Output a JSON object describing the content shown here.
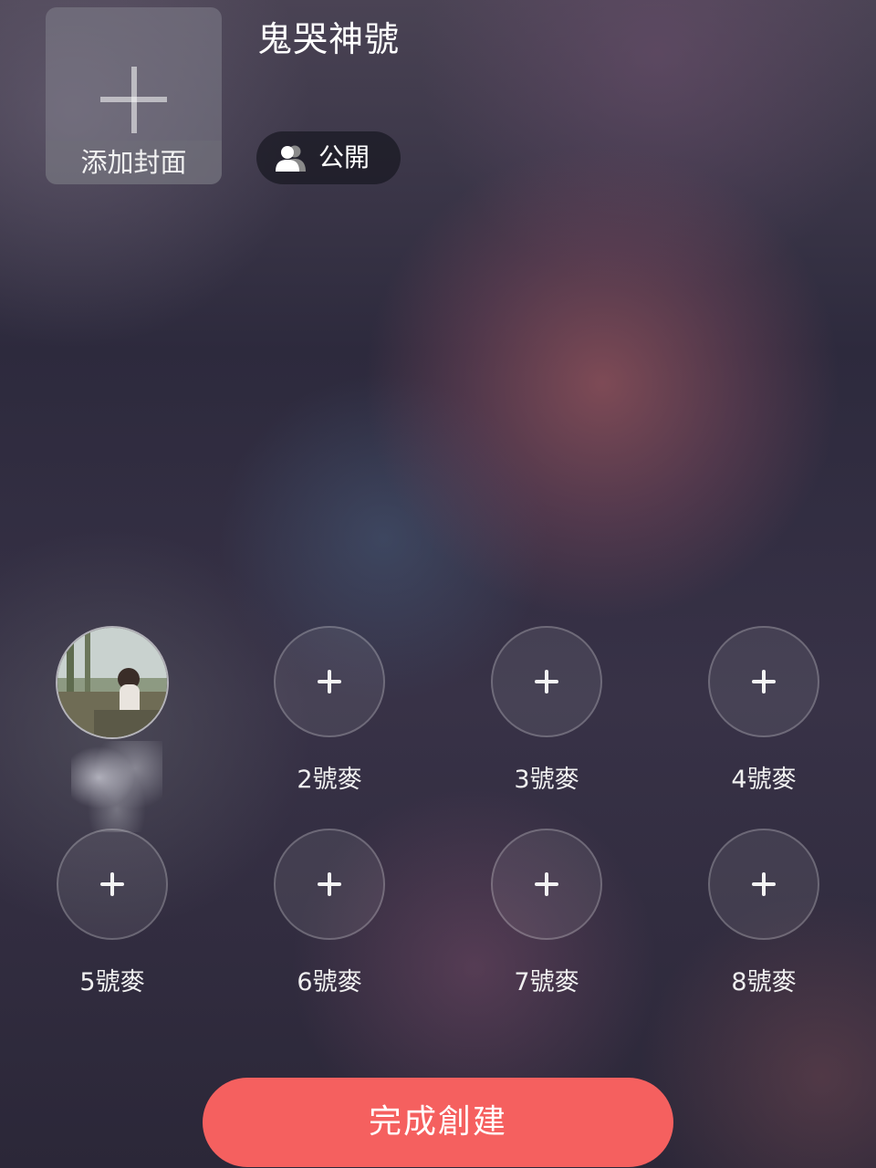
{
  "room": {
    "cover_label": "添加封面",
    "title": "鬼哭神號",
    "visibility": "公開"
  },
  "seats": [
    {
      "label": ""
    },
    {
      "label": "2號麥"
    },
    {
      "label": "3號麥"
    },
    {
      "label": "4號麥"
    },
    {
      "label": "5號麥"
    },
    {
      "label": "6號麥"
    },
    {
      "label": "7號麥"
    },
    {
      "label": "8號麥"
    }
  ],
  "actions": {
    "create_label": "完成創建"
  },
  "colors": {
    "accent": "#f5605f",
    "chip_bg": "#19192366"
  }
}
